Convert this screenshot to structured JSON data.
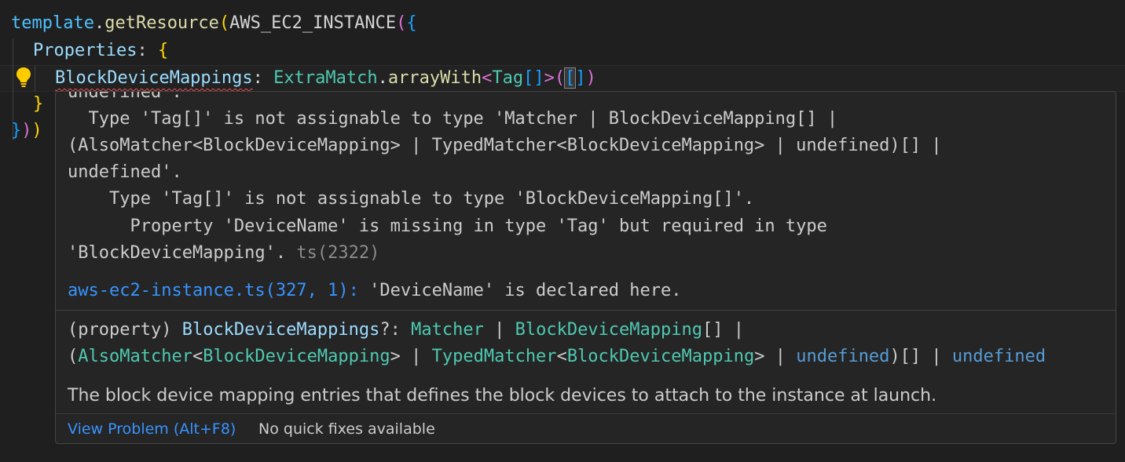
{
  "editor": {
    "line1": {
      "obj": "template",
      "dot": ".",
      "fn": "getResource",
      "open": "(",
      "arg": "AWS_EC2_INSTANCE",
      "open2": "(",
      "open3": "{"
    },
    "line2": {
      "key": "Properties",
      "colon": ": ",
      "open": "{"
    },
    "line3": {
      "key": "BlockDeviceMappings",
      "colon": ": ",
      "obj": "ExtraMatch",
      "dot": ".",
      "fn": "arrayWith",
      "lt": "<",
      "type": "Tag",
      "arr": "[]",
      "gt": ">",
      "open": "(",
      "bracket_open": "[",
      "bracket_close": "]",
      "close": ")"
    },
    "line4": {
      "close": "}"
    },
    "line5": {
      "close1": "}",
      "close2": ")",
      "close3": ")"
    }
  },
  "hover": {
    "cut_line": "undefined'.",
    "error_lines": [
      "  Type 'Tag[]' is not assignable to type 'Matcher | BlockDeviceMapping[] |",
      "(AlsoMatcher<BlockDeviceMapping> | TypedMatcher<BlockDeviceMapping> | undefined)[] |",
      "undefined'.",
      "    Type 'Tag[]' is not assignable to type 'BlockDeviceMapping[]'.",
      "      Property 'DeviceName' is missing in type 'Tag' but required in type"
    ],
    "last_error_line": "'BlockDeviceMapping'.",
    "error_code": "ts(2322)",
    "related_link": "aws-ec2-instance.ts(327, 1):",
    "related_text": " 'DeviceName' is declared here.",
    "signature": {
      "prefix": "(property) ",
      "name": "BlockDeviceMappings",
      "opt": "?: ",
      "t1": "Matcher",
      "p1": " | ",
      "t2": "BlockDeviceMapping",
      "p2": "[] |",
      "p3": "(",
      "t3": "AlsoMatcher",
      "p4": "<",
      "t4": "BlockDeviceMapping",
      "p5": "> | ",
      "t5": "TypedMatcher",
      "p6": "<",
      "t6": "BlockDeviceMapping",
      "p7": "> | ",
      "kw1": "undefined",
      "p8": ")[] | ",
      "kw2": "undefined"
    },
    "doc": "The block device mapping entries that defines the block devices to attach to the instance at launch.",
    "status": {
      "view_problem": "View Problem (Alt+F8)",
      "no_fixes": "No quick fixes available"
    }
  },
  "colors": {
    "background": "#1f1f1f",
    "error": "#f14c4c",
    "link": "#3794ff",
    "bulb": "#ffcc00"
  }
}
